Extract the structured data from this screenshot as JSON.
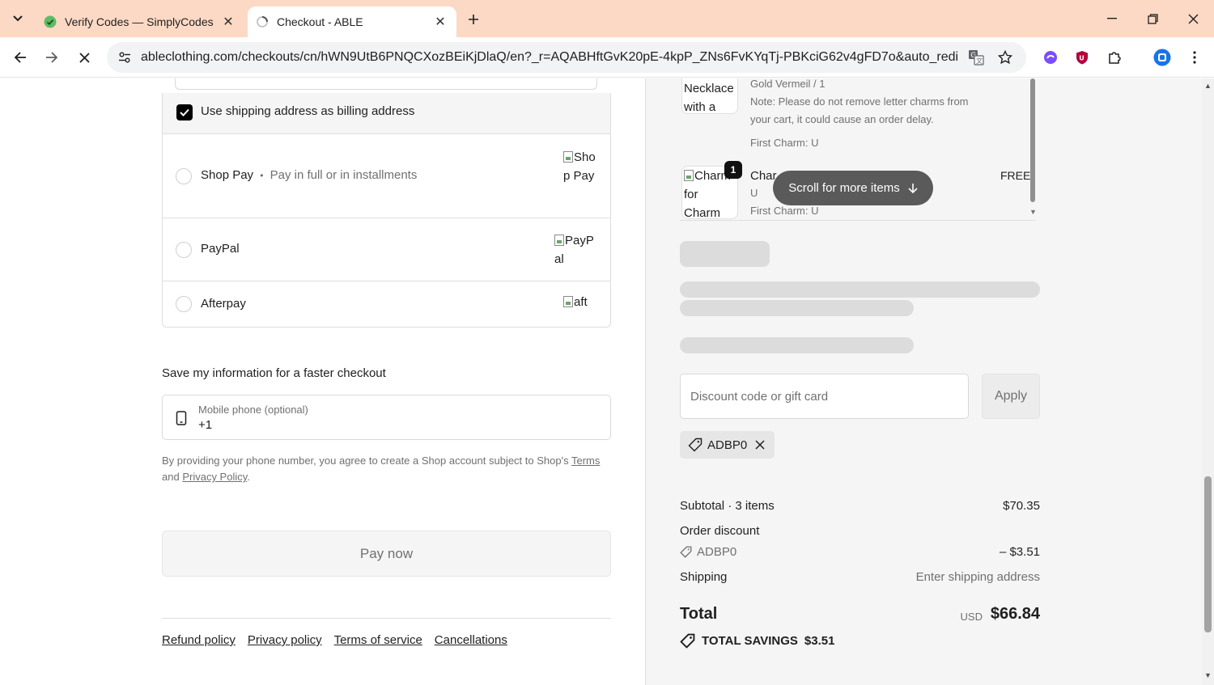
{
  "browser": {
    "tabs": [
      {
        "title": "Verify Codes — SimplyCodes",
        "active": false,
        "icon": "simplycodes-favicon"
      },
      {
        "title": "Checkout - ABLE",
        "active": true,
        "icon": "loading-favicon"
      }
    ],
    "url": "ableclothing.com/checkouts/cn/hWN9UtB6PNQCXozBEiKjDlaQ/en?_r=AQABHftGvK20pE-4kpP_ZNs6FvKYqTj-PBKciG62v4gFD7o&auto_redirect=fal...",
    "accent": "#fcd9c4"
  },
  "checkout": {
    "billing_checkbox_label": "Use shipping address as billing address",
    "payment_options": [
      {
        "name": "Shop Pay",
        "separator": "•",
        "subtitle": "Pay in full or in installments",
        "img_alt": "Shop Pay"
      },
      {
        "name": "PayPal",
        "img_alt": "PayPal"
      },
      {
        "name": "Afterpay",
        "img_alt": "aft"
      }
    ],
    "save_info_title": "Save my information for a faster checkout",
    "phone": {
      "label": "Mobile phone (optional)",
      "value": "+1"
    },
    "legal": {
      "prefix": "By providing your phone number, you agree to create a Shop account subject to Shop's",
      "terms_link": "Terms",
      "and": "and",
      "privacy_link": "Privacy Policy",
      "suffix": "."
    },
    "pay_button": "Pay now",
    "footer_links": [
      "Refund policy",
      "Privacy policy",
      "Terms of service",
      "Cancellations"
    ]
  },
  "order": {
    "items": [
      {
        "thumb_alt": "Necklace with a",
        "meta": [
          "Gold Vermeil / 1",
          "Note: Please do not remove letter charms from",
          "your cart, it could cause an order delay.",
          "First Charm: U"
        ]
      },
      {
        "thumb_alt": "Charm for Charm",
        "quantity": "1",
        "title": "Char",
        "variant": "U",
        "meta": [
          "First Charm: U"
        ],
        "price": "FREE"
      }
    ],
    "scroll_hint": "Scroll for more items",
    "discount_placeholder": "Discount code or gift card",
    "apply_button": "Apply",
    "applied_code": "ADBP0",
    "summary": {
      "subtotal_label": "Subtotal · 3 items",
      "subtotal_value": "$70.35",
      "discount_label": "Order discount",
      "discount_code": "ADBP0",
      "discount_value": "– $3.51",
      "shipping_label": "Shipping",
      "shipping_value": "Enter shipping address",
      "total_label": "Total",
      "total_currency": "USD",
      "total_value": "$66.84",
      "savings_label": "TOTAL SAVINGS",
      "savings_value": "$3.51"
    }
  }
}
